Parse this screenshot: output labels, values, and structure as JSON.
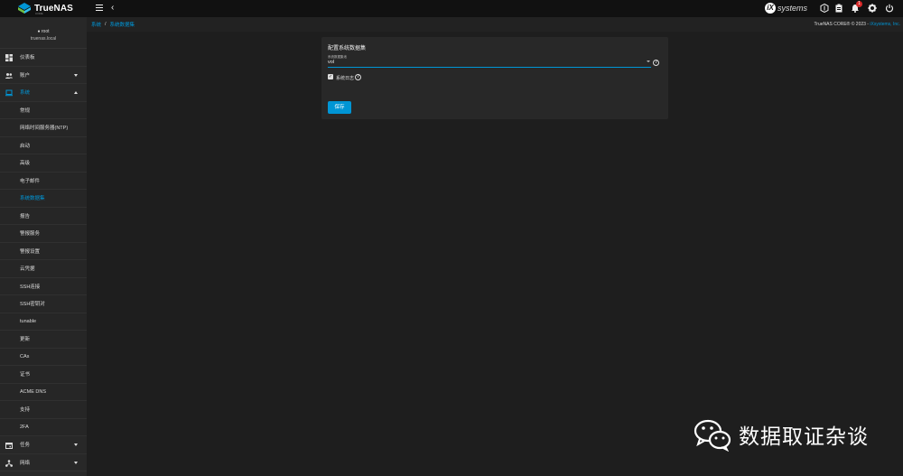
{
  "header": {
    "logo_text": "TrueNAS",
    "logo_subtext": "CORE",
    "ix_mark": "iX",
    "ix_text": "systems",
    "notification_count": "1",
    "icons": [
      "menu-icon",
      "back-chevron-icon",
      "truecommand-icon",
      "directory-services-icon",
      "bell-icon",
      "gear-icon",
      "power-icon"
    ]
  },
  "user": {
    "name": "root",
    "host": "truenas.local"
  },
  "sidebar": {
    "items": [
      {
        "label": "仪表板",
        "icon": "dashboard-icon",
        "caret": ""
      },
      {
        "label": "账户",
        "icon": "accounts-icon",
        "caret": "down"
      },
      {
        "label": "系统",
        "icon": "computer-icon",
        "caret": "up"
      }
    ],
    "sub_items": [
      {
        "label": "常规"
      },
      {
        "label": "网络时间服务器(NTP)"
      },
      {
        "label": "启动"
      },
      {
        "label": "高级"
      },
      {
        "label": "电子邮件"
      },
      {
        "label": "系统数据集",
        "active": true
      },
      {
        "label": "报告"
      },
      {
        "label": "警报服务"
      },
      {
        "label": "警报设置"
      },
      {
        "label": "云凭据"
      },
      {
        "label": "SSH连接"
      },
      {
        "label": "SSH密钥对"
      },
      {
        "label": "tunable"
      },
      {
        "label": "更新"
      },
      {
        "label": "CAs"
      },
      {
        "label": "证书"
      },
      {
        "label": "ACME DNS"
      },
      {
        "label": "支持"
      },
      {
        "label": "2FA"
      }
    ],
    "bottom_items": [
      {
        "label": "任务",
        "icon": "calendar-icon",
        "caret": "down"
      },
      {
        "label": "网络",
        "icon": "network-icon",
        "caret": "down"
      }
    ]
  },
  "breadcrumb": {
    "root": "系统",
    "separator": "/",
    "current": "系统数据集"
  },
  "copyright": {
    "text": "TrueNAS CORE® © 2023 - ",
    "link": "iXsystems, Inc."
  },
  "form": {
    "title": "配置系统数据集",
    "pool_label": "系统数据集池",
    "pool_value": "vol",
    "syslog_label": "系统日志",
    "syslog_checked": true,
    "save_label": "保存"
  },
  "watermark": {
    "text": "数据取证杂谈"
  },
  "colors": {
    "accent": "#0095d5",
    "topbar": "#111111",
    "sidebar": "#282828",
    "background": "#1e1e1e",
    "badge": "#d62828"
  }
}
